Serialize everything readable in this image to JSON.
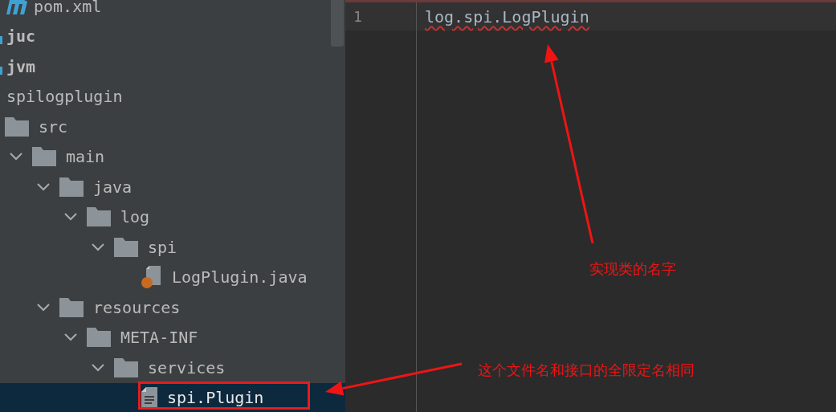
{
  "project_tree": {
    "top_items": [
      {
        "label": "pom.xml",
        "kind": "maven",
        "selected": false
      },
      {
        "label": "juc",
        "kind": "module",
        "selected": false
      },
      {
        "label": "jvm",
        "kind": "module",
        "selected": false
      },
      {
        "label": "spilogplugin",
        "kind": "plain",
        "selected": false
      }
    ],
    "tree": [
      {
        "label": "src",
        "kind": "folder",
        "selected": false,
        "children": [
          {
            "label": "main",
            "kind": "folder",
            "expanded": true,
            "selected": false,
            "children": [
              {
                "label": "java",
                "kind": "folder",
                "expanded": true,
                "selected": false,
                "children": [
                  {
                    "label": "log",
                    "kind": "folder",
                    "expanded": true,
                    "selected": false,
                    "children": [
                      {
                        "label": "spi",
                        "kind": "folder",
                        "expanded": true,
                        "selected": false,
                        "children": [
                          {
                            "label": "LogPlugin.java",
                            "kind": "java",
                            "selected": false
                          }
                        ]
                      }
                    ]
                  }
                ]
              },
              {
                "label": "resources",
                "kind": "folder",
                "expanded": true,
                "selected": false,
                "children": [
                  {
                    "label": "META-INF",
                    "kind": "folder",
                    "expanded": true,
                    "selected": false,
                    "children": [
                      {
                        "label": "services",
                        "kind": "folder",
                        "expanded": true,
                        "selected": false,
                        "children": [
                          {
                            "label": "spi.Plugin",
                            "kind": "text",
                            "selected": true
                          }
                        ]
                      }
                    ]
                  }
                ]
              }
            ]
          }
        ]
      }
    ]
  },
  "editor": {
    "lines": [
      {
        "number": "1",
        "text": "log.spi.LogPlugin",
        "error": true
      }
    ]
  },
  "annotations": [
    {
      "text": "实现类的名字"
    },
    {
      "text": "这个文件名和接口的全限定名相同"
    }
  ]
}
